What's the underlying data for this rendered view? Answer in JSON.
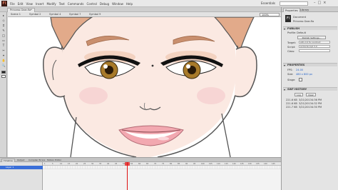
{
  "app": {
    "logo": "Fl",
    "menus": [
      "File",
      "Edit",
      "View",
      "Insert",
      "Modify",
      "Text",
      "Commands",
      "Control",
      "Debug",
      "Window",
      "Help"
    ],
    "workspace": "Essentials",
    "window_buttons": [
      "–",
      "□",
      "×"
    ]
  },
  "document_tab": {
    "label": "Princess Gear.fla*"
  },
  "editbar": {
    "crumbs": [
      "Scene 1",
      "Symbol 2",
      "Symbol 4",
      "Symbol 7",
      "Symbol 9"
    ],
    "zoom": "100%"
  },
  "toolbar": {
    "tools": [
      "▸",
      "◇",
      "⌗",
      "✎",
      "◯",
      "▭",
      "T",
      "✂",
      "⌖",
      "✋",
      "🔍"
    ],
    "stroke_color": "#222222",
    "fill_color": "#ffffff"
  },
  "panel": {
    "tabs": [
      "Properties",
      "Library"
    ],
    "doc_type": "Document",
    "doc_name": "Princess Gear.fla",
    "sections": {
      "publish": "PUBLISH",
      "properties": "PROPERTIES",
      "swf_history": "SWF HISTORY"
    },
    "publish": {
      "profile_label": "Profile: Default",
      "settings_button": "Publish Settings...",
      "target_label": "Target:",
      "target_value": "AIR 2.6 for Android",
      "script_label": "Script:",
      "script_value": "ActionScript 3.0",
      "class_label": "Class:"
    },
    "properties": {
      "fps_label": "FPS:",
      "fps_value": "24.00",
      "size_label": "Size:",
      "size_value": "480 x 800 px",
      "stage_label": "Stage:"
    },
    "swf_history": {
      "log_button": "Log",
      "clear_button": "Clear",
      "rows": [
        [
          "221.6 KB",
          "3/21/2013",
          "4:36 PM"
        ],
        [
          "221.6 KB",
          "3/21/2013",
          "4:32 PM"
        ],
        [
          "221.7 KB",
          "3/21/2013",
          "4:30 PM"
        ]
      ]
    }
  },
  "timeline": {
    "tabs": [
      "Timeline",
      "Output",
      "Compiler Errors",
      "Motion Editor"
    ],
    "layers": [
      "Layer 1"
    ],
    "ruler": [
      "1",
      "5",
      "10",
      "15",
      "20",
      "25",
      "30",
      "35",
      "40",
      "45",
      "50",
      "55",
      "60",
      "65",
      "70",
      "75",
      "80",
      "85",
      "90",
      "95",
      "100",
      "105",
      "110",
      "115",
      "120",
      "125",
      "130",
      "135",
      "140",
      "145"
    ],
    "current_frame": "29"
  },
  "stage_art": {
    "skin_color": "#fbe9e2",
    "hair_color": "#e2aa8a",
    "iris_color": "#a87a2a",
    "lip_color": "#f2a8b0",
    "blush_color": "#f6cfd1",
    "line_color": "#555555"
  }
}
